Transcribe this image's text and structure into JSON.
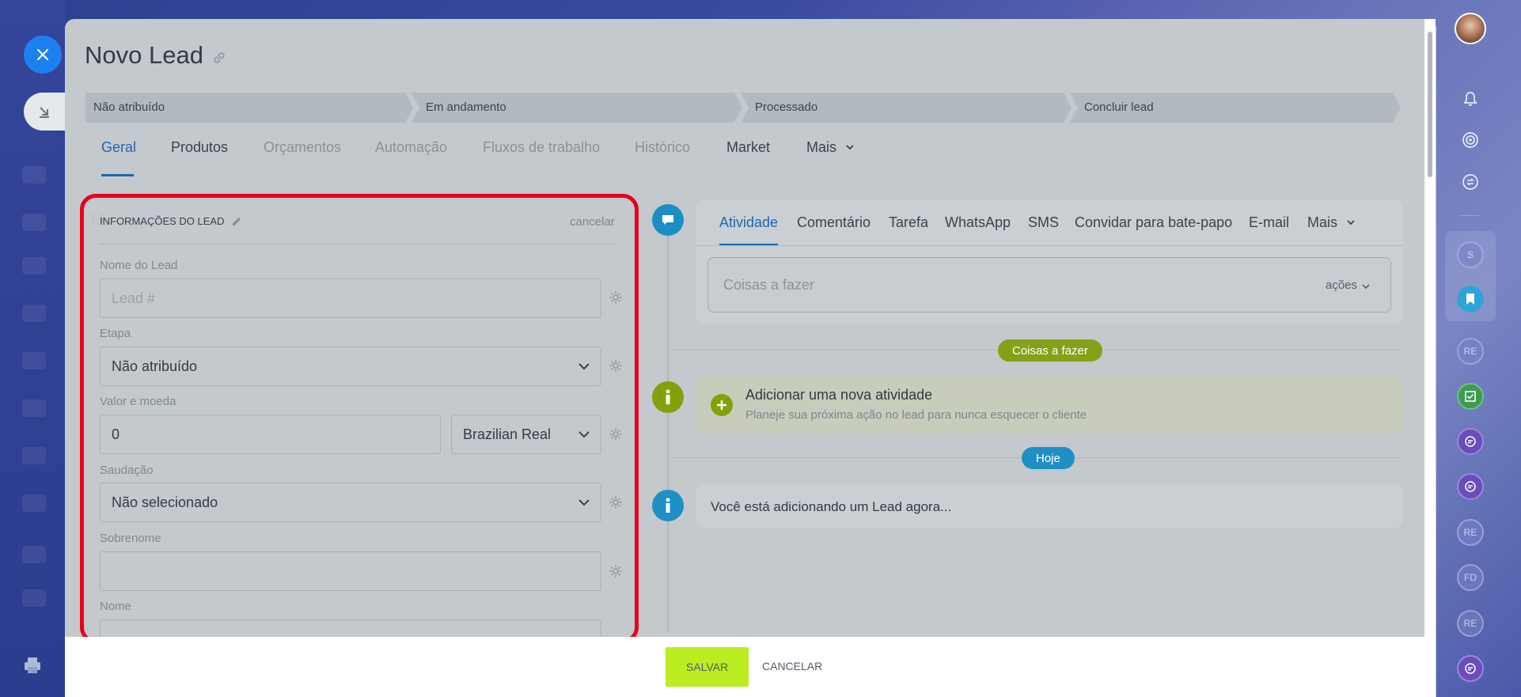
{
  "window": {
    "title": "Novo Lead"
  },
  "pipeline": {
    "stages": [
      "Não atribuído",
      "Em andamento",
      "Processado",
      "Concluir lead"
    ]
  },
  "tabs": [
    {
      "label": "Geral",
      "active": true
    },
    {
      "label": "Produtos"
    },
    {
      "label": "Orçamentos"
    },
    {
      "label": "Automação"
    },
    {
      "label": "Fluxos de trabalho"
    },
    {
      "label": "Histórico"
    },
    {
      "label": "Market"
    },
    {
      "label": "Mais"
    }
  ],
  "form": {
    "section_title": "INFORMAÇÕES DO LEAD",
    "cancel_label": "cancelar",
    "fields": {
      "lead_name": {
        "label": "Nome do Lead",
        "placeholder": "Lead #",
        "value": ""
      },
      "stage": {
        "label": "Etapa",
        "value": "Não atribuído"
      },
      "amount": {
        "label": "Valor e moeda",
        "value": "0",
        "currency": "Brazilian Real"
      },
      "salutation": {
        "label": "Saudação",
        "value": "Não selecionado"
      },
      "last_name": {
        "label": "Sobrenome",
        "value": ""
      },
      "first_name": {
        "label": "Nome",
        "value": ""
      }
    }
  },
  "activity": {
    "tabs": [
      "Atividade",
      "Comentário",
      "Tarefa",
      "WhatsApp",
      "SMS",
      "Convidar para bate-papo",
      "E-mail",
      "Mais"
    ],
    "todo_placeholder": "Coisas a fazer",
    "actions_label": "ações",
    "todo_pill": "Coisas a fazer",
    "add_title": "Adicionar uma nova atividade",
    "add_subtitle": "Planeje sua próxima ação no lead para nunca esquecer o cliente",
    "today_pill": "Hoje",
    "info_text": "Você está adicionando um Lead agora..."
  },
  "footer": {
    "save_label": "SALVAR",
    "cancel_label": "CANCELAR"
  },
  "right_sidebar": {
    "items": [
      "S",
      "RE",
      "RE",
      "FD",
      "RE"
    ]
  },
  "colors": {
    "accent_blue": "#2067b0",
    "close_button": "#1e7ff0",
    "save_button": "#bbed21",
    "highlight_red": "#e6001b",
    "timeline_green": "#83a10a",
    "timeline_blue": "#1b8fc4"
  }
}
